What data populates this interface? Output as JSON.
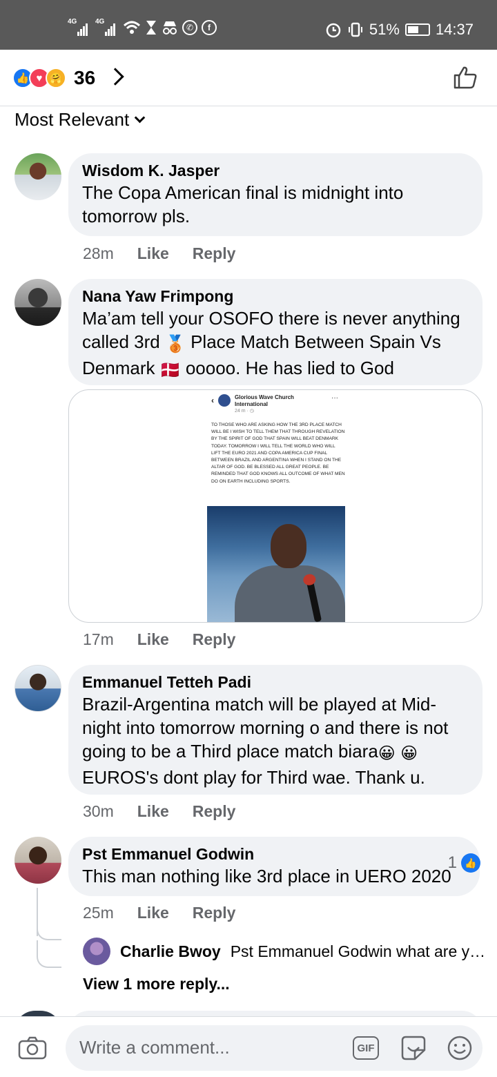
{
  "status_bar": {
    "net1": "4G",
    "net2": "4G",
    "battery": "51%",
    "time": "14:37"
  },
  "reactions": {
    "count": "36",
    "types": [
      "like",
      "love",
      "care"
    ]
  },
  "sort": {
    "label": "Most Relevant"
  },
  "comments": [
    {
      "author": "Wisdom K. Jasper",
      "text": "The Copa American final is midnight into tomorrow pls.",
      "time": "28m",
      "like": "Like",
      "reply": "Reply"
    },
    {
      "author": "Nana Yaw Frimpong",
      "text_a": "Ma’am tell your OSOFO there is never anything called 3rd ",
      "text_b": " Place Match Between Spain Vs Denmark ",
      "text_c": " ooooo. He has lied to God",
      "emoji_medal": "🥉",
      "emoji_flag": "🇩🇰",
      "time": "17m",
      "like": "Like",
      "reply": "Reply",
      "attachment": {
        "page_name": "Glorious Wave Church International",
        "page_sub": "24 m · ◷",
        "dots": "···",
        "post_text": "TO THOSE WHO ARE ASKING HOW THE 3RD PLACE MATCH WILL BE I WISH TO TELL THEM THAT THROUGH REVELATION BY THE SPIRIT OF GOD THAT SPAIN WILL BEAT DENMARK TODAY. TOMORROW I WILL TELL THE WORLD WHO WILL LIFT THE EURO 2021 AND COPA AMERICA CUP FINAL BETWEEN BRAZIL AND ARGENTINA WHEN I STAND ON THE ALTAR OF GOD. BE BLESSED ALL GREAT PEOPLE. BE REMINDED THAT GOD KNOWS ALL OUTCOME OF WHAT MEN DO ON EARTH INCLUDING SPORTS."
      }
    },
    {
      "author": "Emmanuel Tetteh Padi",
      "text_a": "Brazil-Argentina match will be played at Mid-night into tomorrow morning o and there is not going to be a Third place match biara",
      "text_b": " EUROS's dont play for Third wae. Thank u.",
      "emoji": "😀",
      "time": "30m",
      "like": "Like",
      "reply": "Reply"
    },
    {
      "author": "Pst Emmanuel Godwin",
      "text": "This man nothing like 3rd place in UERO 2020",
      "time": "25m",
      "like": "Like",
      "reply": "Reply",
      "reaction_count": "1",
      "reply_preview": {
        "author": "Charlie Bwoy",
        "text": "Pst Emmanuel Godwin  what are you …"
      },
      "view_more": "View 1 more reply..."
    }
  ],
  "composer": {
    "placeholder": "Write a comment...",
    "gif_label": "GIF"
  },
  "colors": {
    "brand_blue": "#1877f2",
    "bubble_bg": "#f0f2f5",
    "meta_gray": "#65676b",
    "status_bar": "#595959"
  }
}
